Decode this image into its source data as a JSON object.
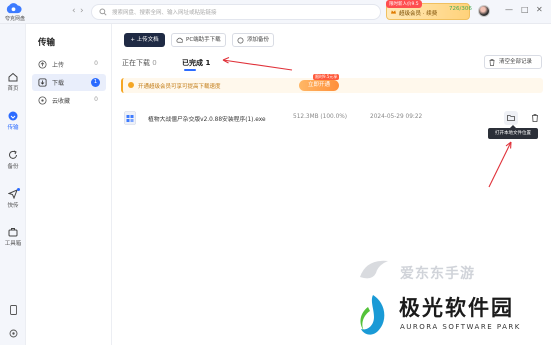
{
  "app": {
    "logo_text": "夸克网盘"
  },
  "search": {
    "placeholder": "搜索网盘、搜索全网、输入网址或粘贴链接"
  },
  "vip": {
    "tag": "限时新人价9.5",
    "label": "超级会员 · 续费",
    "quota": "726/306"
  },
  "window": {
    "minimize": "—",
    "maximize": "□",
    "close": "✕"
  },
  "rail": {
    "items": [
      {
        "label": "首页",
        "icon": "home-icon"
      },
      {
        "label": "传输",
        "icon": "transfer-icon"
      },
      {
        "label": "备份",
        "icon": "backup-icon"
      },
      {
        "label": "快传",
        "icon": "send-icon"
      },
      {
        "label": "工具箱",
        "icon": "toolbox-icon"
      }
    ]
  },
  "sidebar": {
    "title": "传输",
    "items": [
      {
        "label": "上传",
        "count": "0"
      },
      {
        "label": "下载",
        "count": "1"
      },
      {
        "label": "云收藏",
        "count": "0"
      }
    ]
  },
  "toolbar": {
    "upload": "+ 上传文档",
    "batch": "PC端助手下载",
    "backup": "添加备份",
    "clear": "清空全部记录"
  },
  "tabs": {
    "downloading_label": "正在下载",
    "downloading_count": "0",
    "done_label": "已完成",
    "done_count": "1"
  },
  "banner": {
    "text": "开通超级会员可享可提高下载速度",
    "button": "立即开通",
    "button_tag": "限时9.5元享"
  },
  "files": [
    {
      "name": "植物大战僵尸杂交版v2.0.88安装程序(1).exe",
      "size": "512.3MB (100.0%)",
      "date": "2024-05-29 09:22"
    }
  ],
  "tooltip": "打开本地文件位置",
  "watermark": {
    "top": "爱东东手游",
    "cn": "极光软件园",
    "en": "AURORA SOFTWARE PARK"
  },
  "colors": {
    "accent": "#2b6bff",
    "dark_button": "#1f2a44",
    "banner_bg": "#fff8ec",
    "annotation": "#e0323a"
  }
}
